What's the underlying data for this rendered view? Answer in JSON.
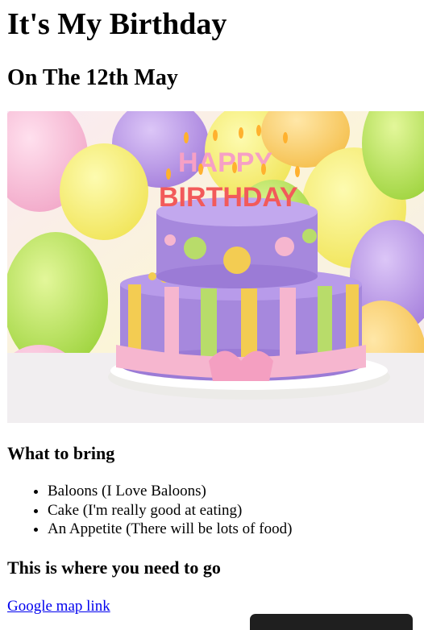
{
  "header": {
    "title": "It's My Birthday",
    "subtitle": "On The 12th May"
  },
  "hero": {
    "icon": "birthday-cake-photo",
    "cake_text_top": "HAPPY",
    "cake_text_bottom": "BIRTHDAY",
    "colors": {
      "balloon_yellow": "#f5ee6a",
      "balloon_green": "#b9e25a",
      "balloon_purple": "#b48ce6",
      "cake_purple": "#a688dd",
      "ribbon_pink": "#f6b6cf",
      "stripe_yellow": "#f3cc52"
    }
  },
  "bring": {
    "heading": "What to bring",
    "items": [
      "Baloons (I Love Baloons)",
      "Cake (I'm really good at eating)",
      "An Appetite (There will be lots of food)"
    ]
  },
  "location": {
    "heading": "This is where you need to go",
    "link_text": "Google map link"
  }
}
